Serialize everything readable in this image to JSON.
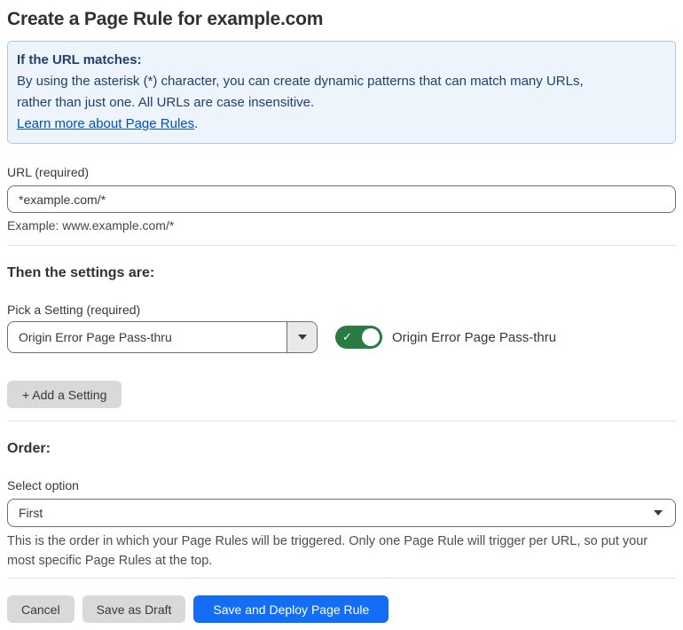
{
  "page": {
    "title": "Create a Page Rule for example.com"
  },
  "info_box": {
    "heading": "If the URL matches:",
    "body_lines": [
      "By using the asterisk (*) character, you can create dynamic patterns that can match many URLs,",
      "rather than just one. All URLs are case insensitive."
    ],
    "link_label": "Learn more about Page Rules",
    "link_suffix": "."
  },
  "url_field": {
    "label": "URL (required)",
    "value": "*example.com/*",
    "helper": "Example: www.example.com/*"
  },
  "settings_section": {
    "heading": "Then the settings are:",
    "picker_label": "Pick a Setting (required)",
    "picker_value": "Origin Error Page Pass-thru",
    "toggle_state": "on",
    "toggle_check_glyph": "✓",
    "toggle_label": "Origin Error Page Pass-thru",
    "add_setting_label": "+ Add a Setting"
  },
  "order_section": {
    "heading": "Order:",
    "select_label": "Select option",
    "select_value": "First",
    "helper": "This is the order in which your Page Rules will be triggered. Only one Page Rule will trigger per URL, so put your most specific Page Rules at the top."
  },
  "footer": {
    "cancel_label": "Cancel",
    "save_draft_label": "Save as Draft",
    "save_deploy_label": "Save and Deploy Page Rule"
  },
  "colors": {
    "info_background": "#edf4fc",
    "info_border": "#abc7e8",
    "info_text": "#20406e",
    "link_blue": "#0051c3",
    "toggle_green": "#267c41",
    "button_gray": "#d9d9d9",
    "primary_blue": "#146ef5",
    "divider_gray": "#e2e2e2"
  }
}
